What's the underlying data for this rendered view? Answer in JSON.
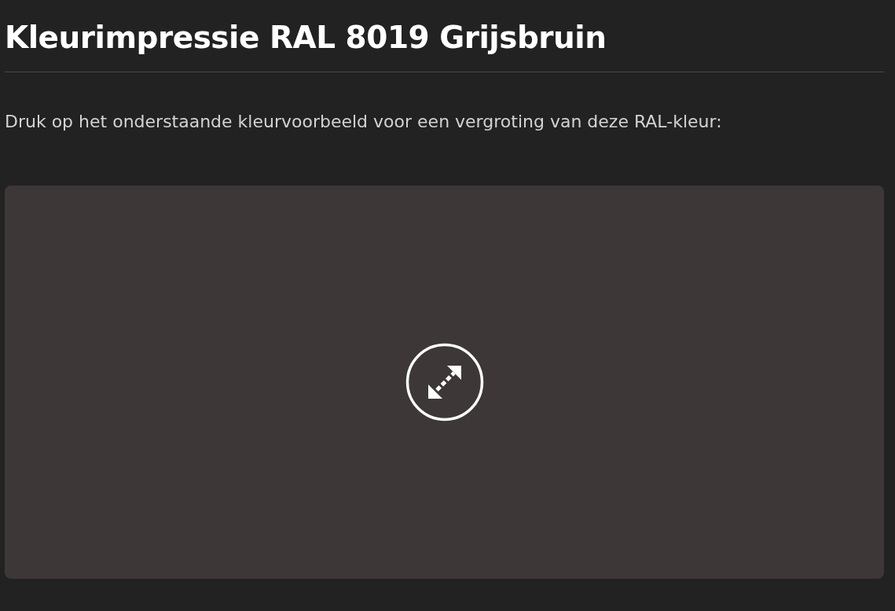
{
  "title": "Kleurimpressie RAL 8019 Grijsbruin",
  "intro": "Druk op het onderstaande kleurvoorbeeld voor een vergroting van deze RAL-kleur:"
}
